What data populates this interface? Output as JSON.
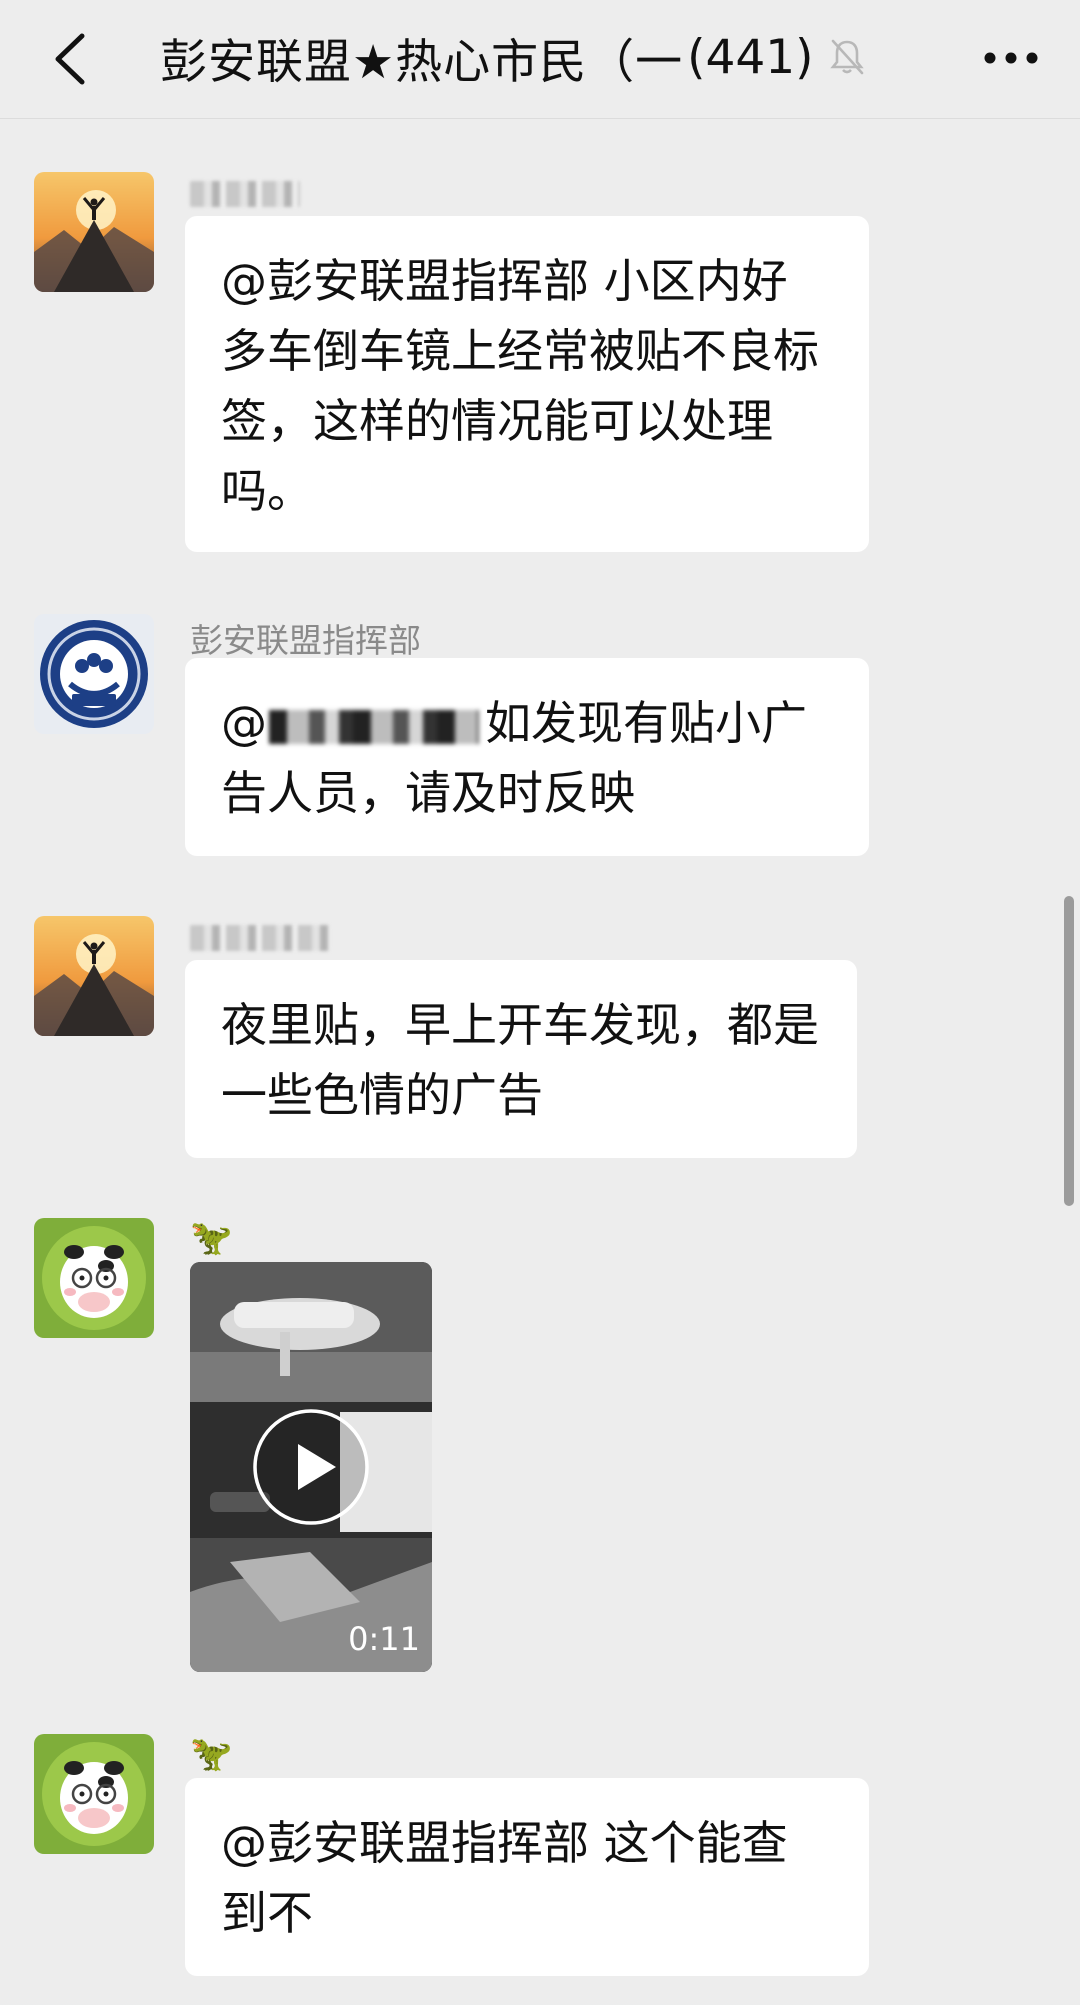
{
  "header": {
    "title": "彭安联盟★热心市民（一",
    "member_count": "(441)",
    "back_icon": "chevron-left-icon",
    "mute_icon": "bell-off-icon",
    "more_icon": "more-dots-icon"
  },
  "messages": [
    {
      "sender": "",
      "avatar_icon": "mountain-person-avatar",
      "text": "@彭安联盟指挥部 小区内好多车倒车镜上经常被贴不良标签，这样的情况能可以处理吗。"
    },
    {
      "sender": "彭安联盟指挥部",
      "avatar_icon": "police-badge-avatar",
      "mention_prefix": "@",
      "text": "如发现有贴小广告人员，请及时反映"
    },
    {
      "sender": "",
      "avatar_icon": "mountain-person-avatar",
      "text": "夜里贴，早上开车发现，都是一些色情的广告"
    },
    {
      "sender": "🦖",
      "avatar_icon": "cow-avatar",
      "video": {
        "duration": "0:11",
        "play_icon": "play-icon"
      }
    },
    {
      "sender": "🦖",
      "avatar_icon": "cow-avatar",
      "text": "@彭安联盟指挥部 这个能查到不"
    }
  ],
  "colors": {
    "background": "#ededed",
    "bubble": "#ffffff",
    "sender_text": "#8a8a8a"
  }
}
